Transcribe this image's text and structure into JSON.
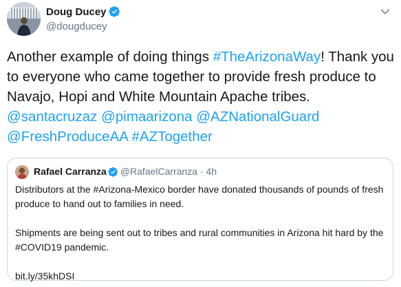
{
  "tweet": {
    "author_name": "Doug Ducey",
    "handle": "@dougducey",
    "avatar_icon": "profile-photo",
    "verified_icon": "verified-badge-icon",
    "menu_icon": "chevron-down-icon",
    "link_color": "#1da1f2",
    "text_before_tag": "Another example of doing things ",
    "hashtag_arizonaway": "#TheArizonaWay",
    "text_after_tag": "! Thank you to everyone who came together to provide fresh produce to Navajo, Hopi and White Mountain Apache tribes. ",
    "mentions": [
      "@santacruzaz",
      "@pimaarizona",
      "@AZNationalGuard",
      "@FreshProduceAA"
    ],
    "hashtag_aztogether": "#AZTogether"
  },
  "quoted_tweet": {
    "author_name": "Rafael Carranza",
    "handle": "@RafaelCarranza",
    "separator": "·",
    "time": "4h",
    "paragraphs": [
      "Distributors at the #Arizona-Mexico border have donated thousands of pounds of fresh produce to hand out to families in need.",
      "Shipments are being sent out to tribes and rural communities in Arizona hit hard by the #COVID19 pandemic.",
      "bit.ly/35khDSI"
    ]
  }
}
